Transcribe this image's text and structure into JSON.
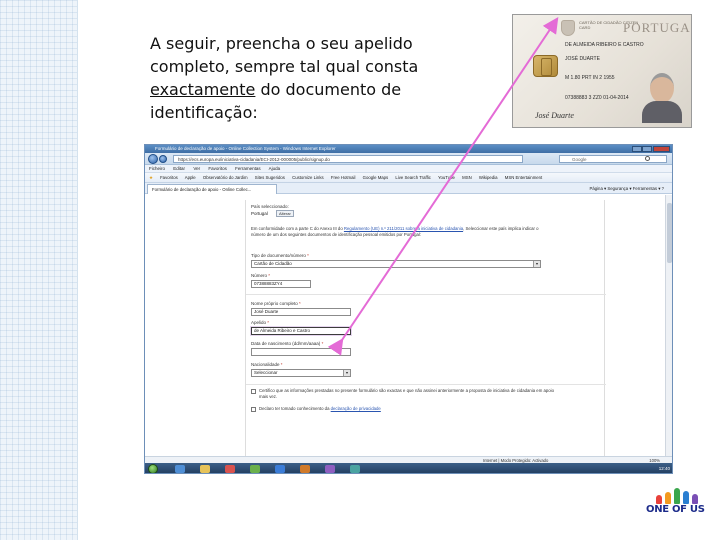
{
  "slide": {
    "line1": "A seguir, preencha o seu apelido",
    "line2": "completo, sempre tal qual consta",
    "line3_underlined": "exactamente",
    "line3_rest": " do documento de",
    "line4": "identificação:"
  },
  "id_card": {
    "issuer": "CARTÃO DE CIDADÃO CITIZEN CARD",
    "country": "PORTUGAL",
    "surname_value": "DE ALMEIDA RIBEIRO E CASTRO",
    "given_name_value": "JOSÉ DUARTE",
    "nationality_row": "M   1.80   PRT        IN 2 1955",
    "document_number": "07388883  3 ZZ0  01-04-2014",
    "signature": "José Duarte"
  },
  "browser": {
    "window_title": "Formulário de declaração de apoio - Online Collection System - Windows Internet Explorer",
    "address": "https://ecs.europa.eu/iniciativa-cidadania/ECI-2012-000005/public/signup.do",
    "search_engine": "Google",
    "menu": [
      "Ficheiro",
      "Editar",
      "Ver",
      "Favoritos",
      "Ferramentas",
      "Ajuda"
    ],
    "favorites_label": "Favoritos",
    "favorites": [
      "Apple",
      "Observatório do Jardim",
      "Sites Sugeridos",
      "Customize Links",
      "Free Hotmail",
      "Google Maps",
      "Live Search Traffic",
      "YouTube",
      "MSN",
      "Wikipedia",
      "MSN Entertainment"
    ],
    "tab_title": "Formulário de declaração de apoio - Online Collec...",
    "command_bar": "Página ▾  Segurança ▾  Ferramentas ▾  ?",
    "form": {
      "country_label": "País seleccionado:",
      "country_value": "Portugal",
      "change_button": "Alterar",
      "notice_prefix": "Em conformidade com a parte C do Anexo III do ",
      "notice_link": "Regulamento (UE) n.º 211/2011 sobre a iniciativa de cidadania",
      "notice_suffix": ", Seleccionar este país implica indicar o número de um dos seguintes documentos de identificação pessoal emitidos por Portugal:",
      "doc_type_label": "Tipo de documento/número",
      "doc_type_value": "Cartão de Cidadão",
      "number_label": "Número",
      "number_value": "07388883ZY4",
      "fullname_label": "Nome próprio completo",
      "fullname_value": "José Duarte",
      "surname_label": "Apelido",
      "surname_value": "de Almeida Ribeiro e Castro",
      "birthdate_label": "Data de nascimento (dd/mm/aaaa)",
      "birthdate_value": "",
      "nationality_label": "Nacionalidade",
      "nationality_value": "Seleccionar",
      "required_mark": "*",
      "consent1_text": "Certifico que as informações prestadas no presente formulário são exactas e que não assinei anteriormente a proposta de iniciativa de cidadania em apoio mais vez.",
      "consent2_prefix": "Declaro ter tomado conhecimento da ",
      "consent2_link": "declaração de privacidade"
    },
    "status_zone": "Internet | Modo Protegido: Activado",
    "status_zoom": "100%",
    "tray_time": "12:40"
  },
  "logo": {
    "text": "ONE OF US",
    "figure_colors": [
      "#e8413b",
      "#f39a1f",
      "#3aa64c",
      "#2b7fd1",
      "#7a4fb5"
    ]
  },
  "colors": {
    "pointer": "#e46bd6",
    "accent_blue": "#3e6ea5"
  }
}
